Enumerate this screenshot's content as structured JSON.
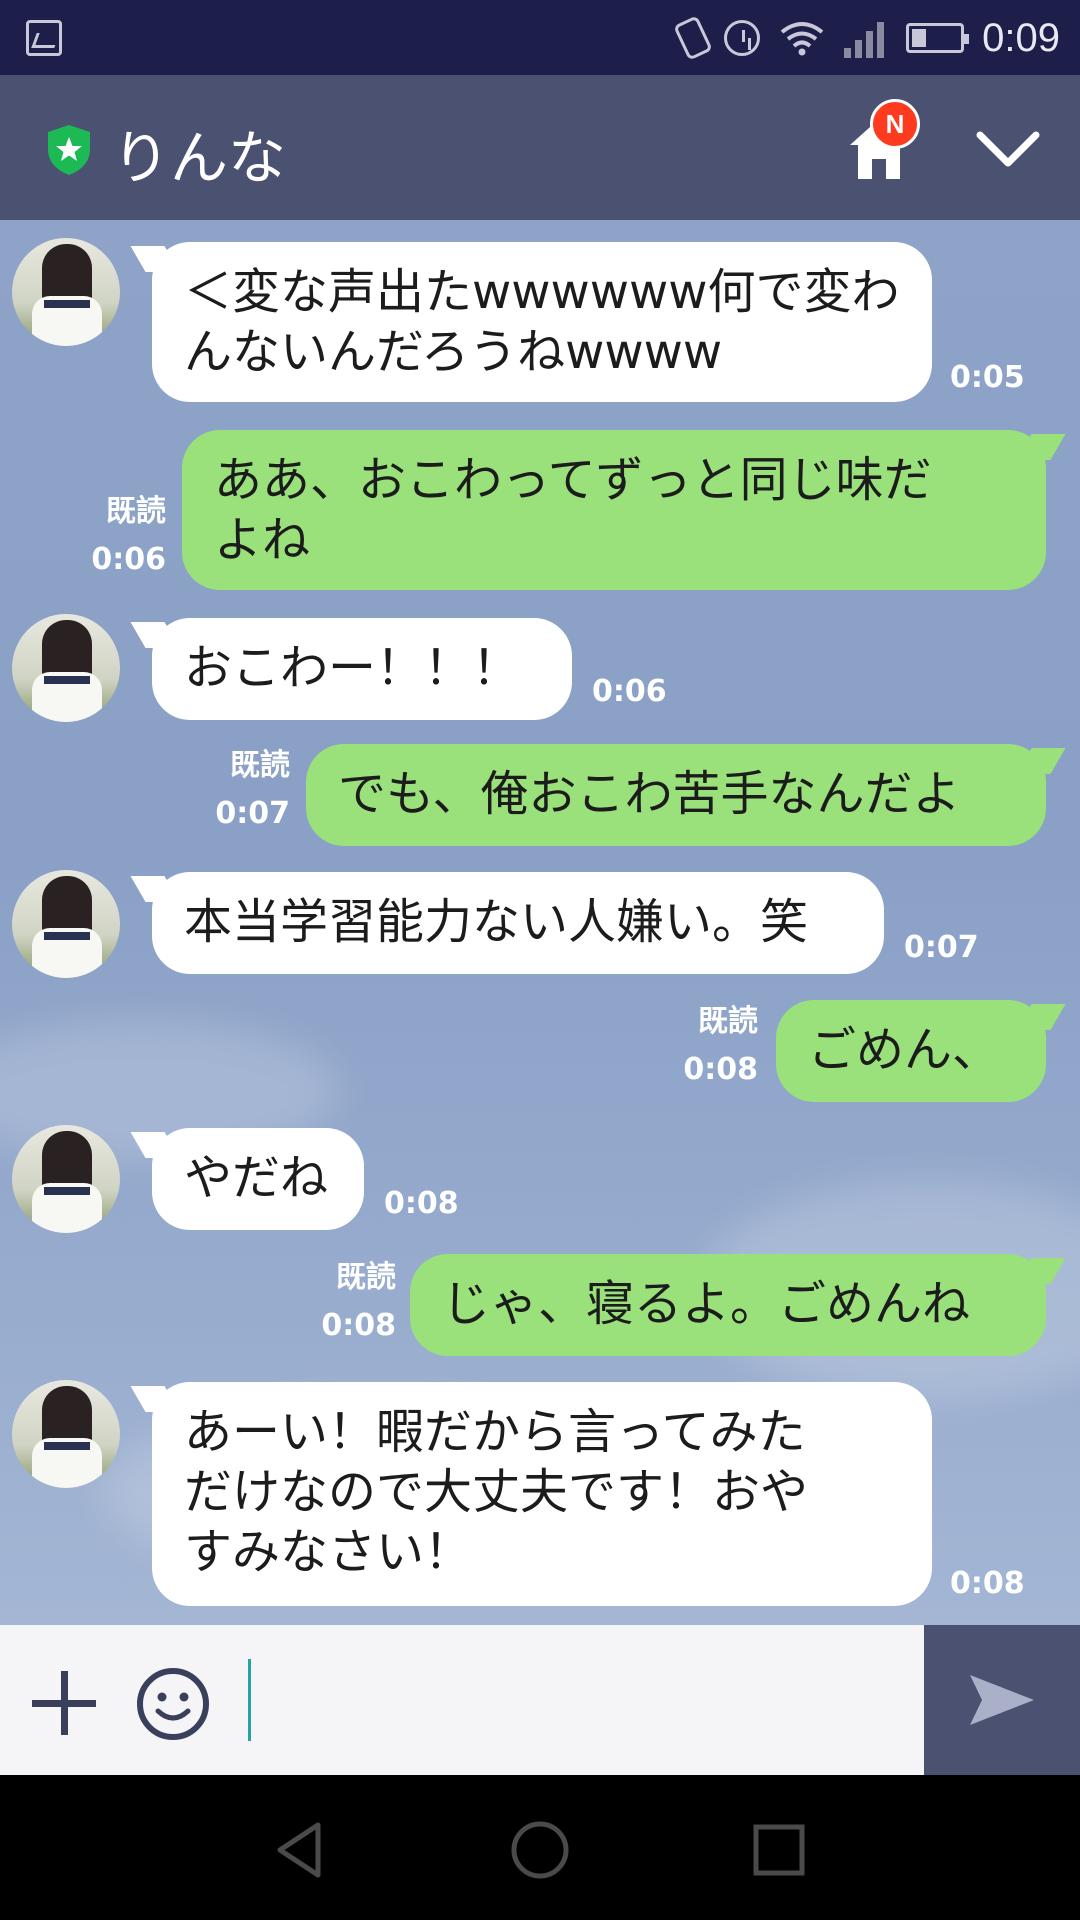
{
  "status_bar": {
    "time": "0:09"
  },
  "header": {
    "contact_name": "りんな",
    "home_badge": "N"
  },
  "messages": [
    {
      "from": "other",
      "text": "＜変な声出たwwwwww何で変わ\nんないんだろうねwwww",
      "time": "0:05"
    },
    {
      "from": "me",
      "text": "ああ、おこわってずっと同じ味だ\nよね",
      "read": "既読",
      "time": "0:06"
    },
    {
      "from": "other",
      "text": "おこわー！！！",
      "time": "0:06"
    },
    {
      "from": "me",
      "text": "でも、俺おこわ苦手なんだよ",
      "read": "既読",
      "time": "0:07"
    },
    {
      "from": "other",
      "text": "本当学習能力ない人嫌い。笑",
      "time": "0:07"
    },
    {
      "from": "me",
      "text": "ごめん、",
      "read": "既読",
      "time": "0:08"
    },
    {
      "from": "other",
      "text": "やだね",
      "time": "0:08"
    },
    {
      "from": "me",
      "text": "じゃ、寝るよ。ごめんね",
      "read": "既読",
      "time": "0:08"
    },
    {
      "from": "other",
      "text": "あーい！暇だから言ってみた\nだけなので大丈夫です！おや\nすみなさい！",
      "time": "0:08"
    }
  ],
  "input": {
    "value": "",
    "placeholder": ""
  },
  "colors": {
    "header": "#4b5170",
    "sent_bubble": "#9ae17b",
    "recv_bubble": "#ffffff",
    "badge": "#ff3b1f"
  }
}
